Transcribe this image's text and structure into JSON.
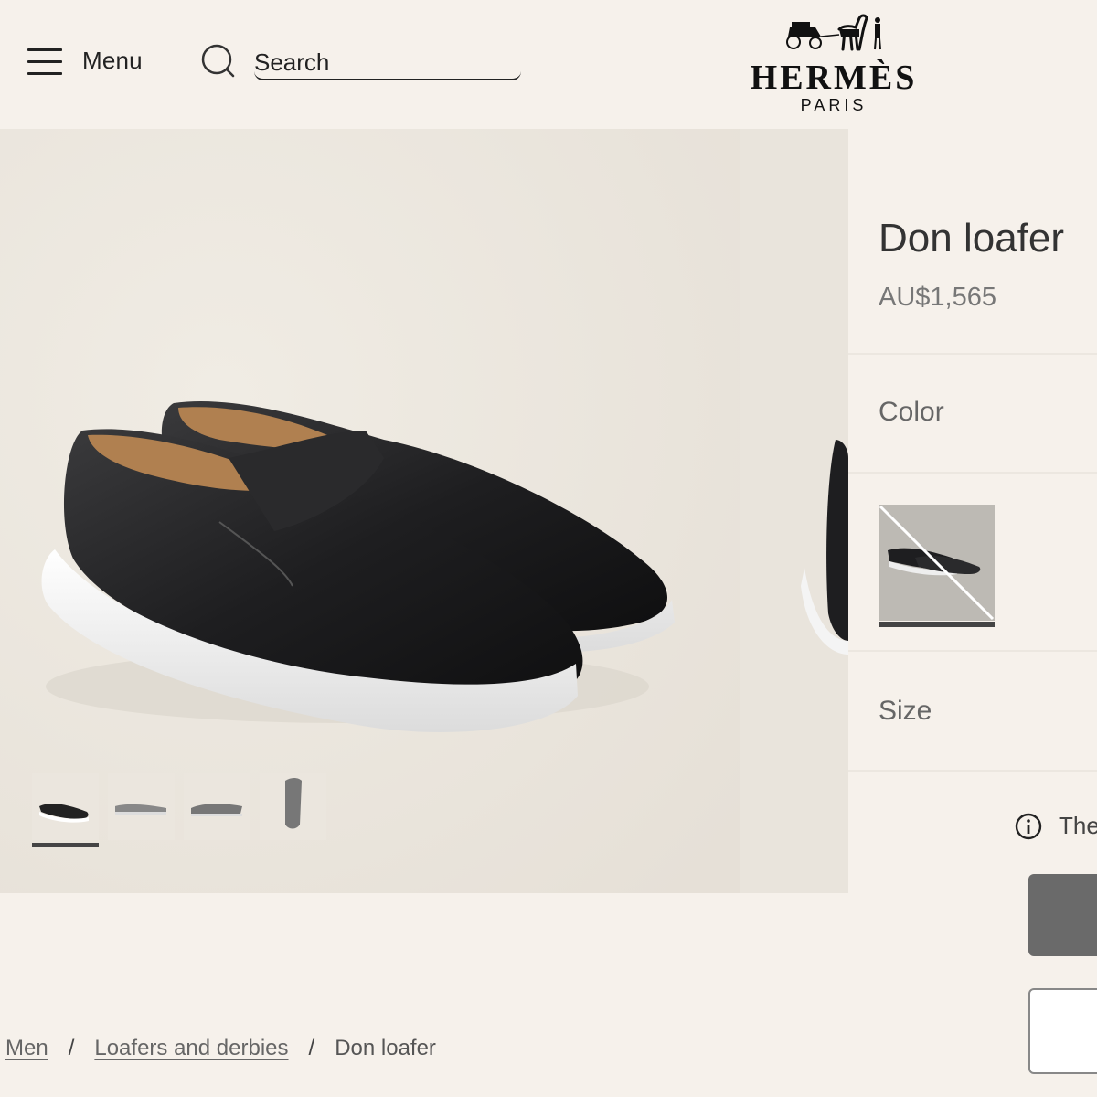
{
  "header": {
    "menu_label": "Menu",
    "search_placeholder": "Search",
    "brand": "HERMÈS",
    "brand_city": "PARIS"
  },
  "gallery": {
    "thumbnails": [
      "front-three-quarter view",
      "side view",
      "side view angled",
      "top view"
    ],
    "active_index": 0
  },
  "product": {
    "title": "Don loafer",
    "price": "AU$1,565",
    "color_label": "Color",
    "size_label": "Size",
    "info_text": "The"
  },
  "breadcrumb": {
    "items": [
      "Men",
      "Loafers and derbies"
    ],
    "separator": "/",
    "current": "Don loafer"
  },
  "colors": {
    "background": "#f6f1eb",
    "gallery_bg": "#ebe6de",
    "text": "#444444",
    "primary_button": "#6a6a6a"
  }
}
